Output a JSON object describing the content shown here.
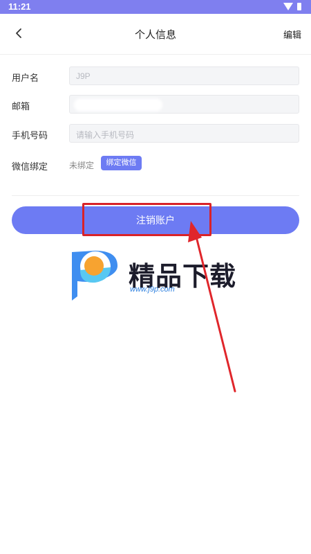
{
  "status_bar": {
    "time": "11:21",
    "icons": [
      "wifi-icon",
      "battery-icon"
    ]
  },
  "header": {
    "back_icon": "chevron-left-icon",
    "title": "个人信息",
    "edit_label": "编辑"
  },
  "form": {
    "username": {
      "label": "用户名",
      "value": "J9P"
    },
    "email": {
      "label": "邮箱",
      "value": ""
    },
    "phone": {
      "label": "手机号码",
      "placeholder": "请输入手机号码"
    },
    "wechat": {
      "label": "微信绑定",
      "status": "未绑定",
      "bind_button": "绑定微信"
    }
  },
  "actions": {
    "deactivate_label": "注销账户"
  },
  "watermark": {
    "brand_text": "精品下载",
    "url": "www.j9p.com"
  },
  "colors": {
    "accent": "#6d7bf3",
    "status_bar": "#7f7fef",
    "annotation": "#d92228"
  }
}
